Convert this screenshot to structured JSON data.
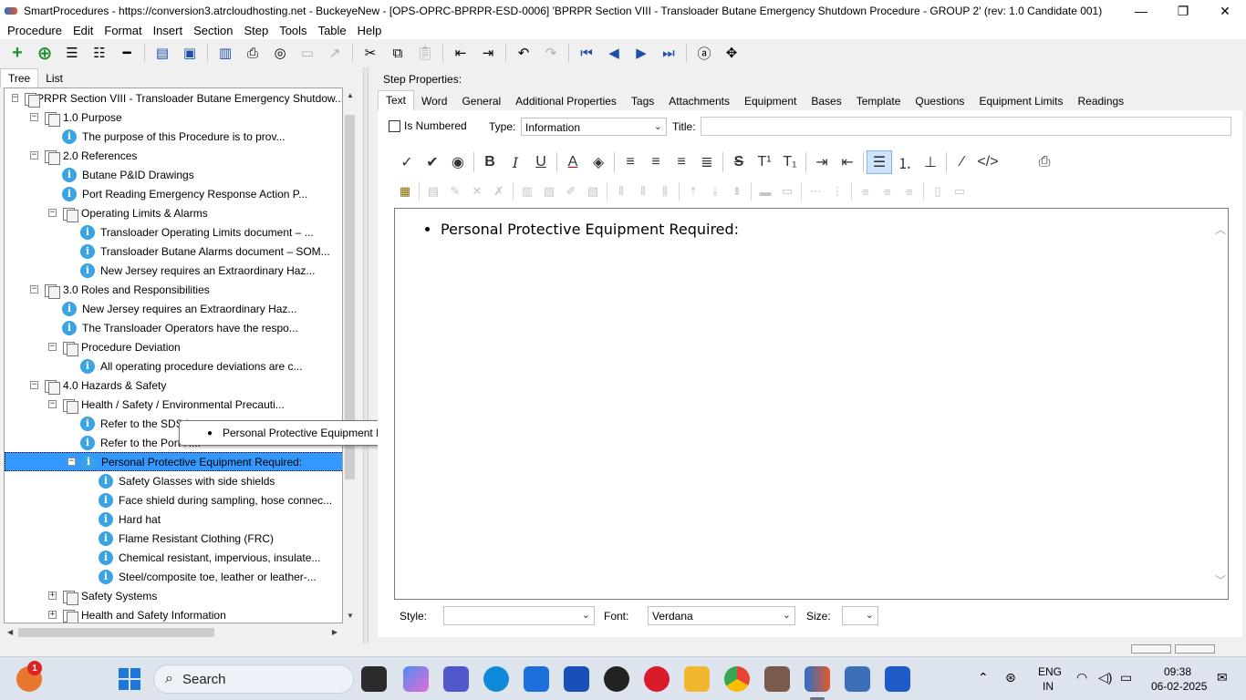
{
  "window": {
    "title": "SmartProcedures - https://conversion3.atrcloudhosting.net - BuckeyeNew - [OPS-OPRC-BPRPR-ESD-0006] 'BPRPR Section VIII - Transloader Butane Emergency Shutdown Procedure - GROUP 2' (rev: 1.0 Candidate 001)",
    "minimize": "—",
    "maximize": "❐",
    "close": "✕"
  },
  "menu": [
    "Procedure",
    "Edit",
    "Format",
    "Insert",
    "Section",
    "Step",
    "Tools",
    "Table",
    "Help"
  ],
  "left_tabs": [
    "Tree",
    "List"
  ],
  "tree": [
    {
      "level": 0,
      "expander": "−",
      "icon": "folder",
      "label": "BPRPR Section VIII - Transloader Butane Emergency Shutdow..."
    },
    {
      "level": 1,
      "expander": "−",
      "icon": "folder",
      "label": "1.0 Purpose"
    },
    {
      "level": 2,
      "expander": "",
      "icon": "info",
      "label": "The purpose of this Procedure is to prov..."
    },
    {
      "level": 1,
      "expander": "−",
      "icon": "folder",
      "label": "2.0 References"
    },
    {
      "level": 2,
      "expander": "",
      "icon": "info",
      "label": "Butane P&ID Drawings"
    },
    {
      "level": 2,
      "expander": "",
      "icon": "info",
      "label": "Port Reading Emergency Response Action P..."
    },
    {
      "level": 2,
      "expander": "−",
      "icon": "folder",
      "label": "Operating Limits & Alarms"
    },
    {
      "level": 3,
      "expander": "",
      "icon": "info",
      "label": "Transloader Operating Limits document – ..."
    },
    {
      "level": 3,
      "expander": "",
      "icon": "info",
      "label": "Transloader Butane Alarms document – SOM..."
    },
    {
      "level": 3,
      "expander": "",
      "icon": "info",
      "label": "New Jersey requires an Extraordinary Haz..."
    },
    {
      "level": 1,
      "expander": "−",
      "icon": "folder",
      "label": "3.0 Roles and Responsibilities"
    },
    {
      "level": 2,
      "expander": "",
      "icon": "info",
      "label": "New Jersey requires an Extraordinary Haz..."
    },
    {
      "level": 2,
      "expander": "",
      "icon": "info",
      "label": "The Transloader Operators have the respo..."
    },
    {
      "level": 2,
      "expander": "−",
      "icon": "folder",
      "label": "Procedure Deviation"
    },
    {
      "level": 3,
      "expander": "",
      "icon": "info",
      "label": "All operating procedure deviations are c..."
    },
    {
      "level": 1,
      "expander": "−",
      "icon": "folder",
      "label": "4.0 Hazards & Safety"
    },
    {
      "level": 2,
      "expander": "−",
      "icon": "folder",
      "label": "Health / Safety / Environmental Precauti..."
    },
    {
      "level": 3,
      "expander": "",
      "icon": "info",
      "label": "Refer to the SDS in..."
    },
    {
      "level": 3,
      "expander": "",
      "icon": "info",
      "label": "Refer to the Port R..."
    },
    {
      "level": 3,
      "expander": "−",
      "icon": "info",
      "label": "Personal Protective Equipment Required:",
      "selected": true
    },
    {
      "level": 4,
      "expander": "",
      "icon": "info",
      "label": "Safety Glasses with side shields"
    },
    {
      "level": 4,
      "expander": "",
      "icon": "info",
      "label": "Face shield during sampling, hose connec..."
    },
    {
      "level": 4,
      "expander": "",
      "icon": "info",
      "label": "Hard hat"
    },
    {
      "level": 4,
      "expander": "",
      "icon": "info",
      "label": "Flame Resistant Clothing (FRC)"
    },
    {
      "level": 4,
      "expander": "",
      "icon": "info",
      "label": "Chemical resistant, impervious, insulate..."
    },
    {
      "level": 4,
      "expander": "",
      "icon": "info",
      "label": "Steel/composite toe, leather or leather-..."
    },
    {
      "level": 2,
      "expander": "+",
      "icon": "folder",
      "label": "Safety Systems"
    },
    {
      "level": 2,
      "expander": "+",
      "icon": "folder",
      "label": "Health and Safety Information"
    }
  ],
  "tooltip": {
    "text": "Personal Protective Equipment Required:"
  },
  "step_properties": {
    "label": "Step Properties:",
    "tabs": [
      "Text",
      "Word",
      "General",
      "Additional Properties",
      "Tags",
      "Attachments",
      "Equipment",
      "Bases",
      "Template",
      "Questions",
      "Equipment Limits",
      "Readings"
    ],
    "is_numbered_label": "Is Numbered",
    "type_label": "Type:",
    "type_value": "Information",
    "title_label": "Title:",
    "title_value": "",
    "editor_text": "Personal Protective Equipment Required:",
    "style_label": "Style:",
    "style_value": "",
    "font_label": "Font:",
    "font_value": "Verdana",
    "size_label": "Size:",
    "size_value": ""
  },
  "taskbar": {
    "search_label": "Search",
    "notification_count": "1",
    "language": "ENG",
    "region": "IN",
    "time": "09:38",
    "date": "06-02-2025"
  },
  "colors": {
    "selection": "#3399ff",
    "info_icon": "#3aa3e3",
    "accent": "#1f4fa8"
  }
}
